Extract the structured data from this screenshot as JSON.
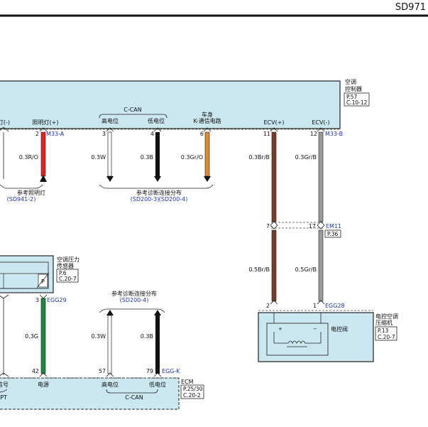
{
  "page_code": "SD971",
  "ac_controller": {
    "name_line1": "空调",
    "name_line2": "控制器",
    "ref_p": "P.57",
    "ref_c": "C.10-12",
    "can_title": "C-CAN",
    "body_title_line1": "车身",
    "body_title_line2": "K-通信电路",
    "pins": [
      {
        "label": "灯(-)",
        "num": ""
      },
      {
        "label": "照明灯(+)",
        "num": "2",
        "connector": "M33-A"
      },
      {
        "label": "高电位",
        "num": "3"
      },
      {
        "label": "低电位",
        "num": "4"
      },
      {
        "label": "",
        "num": "6"
      },
      {
        "label": "ECV(+)",
        "num": "11"
      },
      {
        "label": "ECV(-)",
        "num": "12",
        "connector": "M33-B"
      }
    ]
  },
  "wires_top": [
    {
      "spec": "0.3R/O",
      "color": "#e52020"
    },
    {
      "spec": "0.3W",
      "color": "#ffffff"
    },
    {
      "spec": "0.3B",
      "color": "#111111"
    },
    {
      "spec": "0.3Gr/O",
      "color": "#e08a2c"
    },
    {
      "spec": "0.3Br/B",
      "color": "#7a3b22"
    },
    {
      "spec": "0.3Gr/B",
      "color": "#9a9a9a"
    }
  ],
  "ref_lamp": {
    "title": "参考照明灯",
    "ref": "(SD941-2)"
  },
  "ref_diag_top": {
    "title": "参考诊断连接分布",
    "ref1": "(SD200-3)",
    "ref2": "(SD200-4)"
  },
  "em11": {
    "connector": "EM11",
    "ref_p": "P.36",
    "pin_left": "7",
    "pin_right": "17"
  },
  "wires_mid": [
    {
      "spec": "0.5Br/B",
      "color": "#7a3b22"
    },
    {
      "spec": "0.5Gr/B",
      "color": "#9a9a9a"
    }
  ],
  "compressor": {
    "name_line1": "电控空调",
    "name_line2": "压缩机",
    "ref_p": "P.13",
    "ref_c": "C.20-7",
    "valve_label": "电控阀",
    "connector": "EGG28",
    "pin_left": "2",
    "pin_right": "1",
    "plus": "+",
    "minus": "−"
  },
  "pressure_sensor": {
    "name_line1": "空调压力",
    "name_line2": "传感器",
    "ref_p": "P.6",
    "ref_c": "C.20-7",
    "pin": "3",
    "connector": "EGG29",
    "symbol": "P"
  },
  "ref_diag_bottom": {
    "title": "参考诊断连接分布",
    "ref": "(SD200-4)"
  },
  "wires_bottom": [
    {
      "spec": "0.3G",
      "color": "#1d8a3a"
    },
    {
      "spec": "0.3W",
      "color": "#ffffff"
    },
    {
      "spec": "0.3B",
      "color": "#111111"
    }
  ],
  "ecm": {
    "name": "ECM",
    "ref_p": "P.25/30",
    "ref_c": "C.20-2",
    "can_title": "C-CAN",
    "connector": "EGG-K",
    "pins": [
      {
        "label": "信号",
        "num": ""
      },
      {
        "label": "电源",
        "num": "42"
      },
      {
        "label": "高电位",
        "num": "57"
      },
      {
        "label": "低电位",
        "num": "79"
      }
    ],
    "left_fragment": "LPT"
  }
}
